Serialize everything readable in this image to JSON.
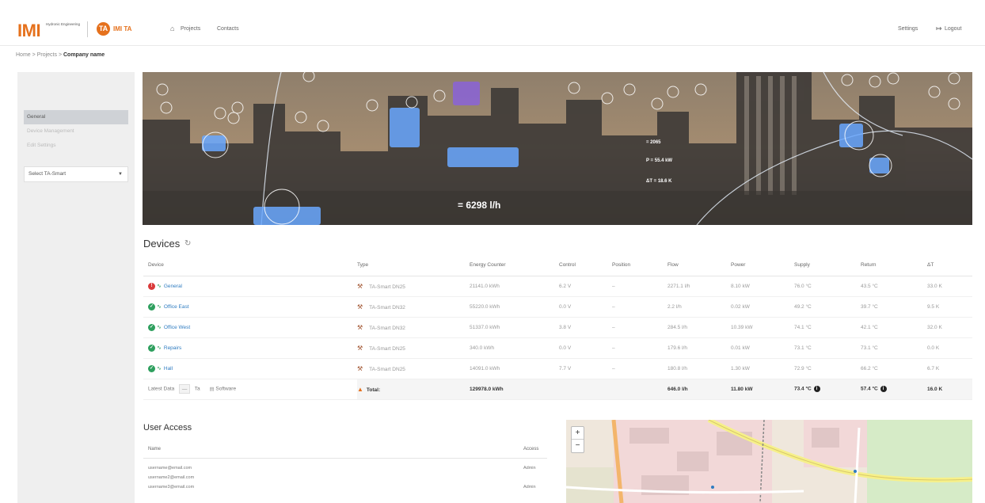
{
  "header": {
    "logo_imi": "IMI",
    "logo_imi_sub": "Hydronic Engineering",
    "logo_ta_icon": "TA",
    "logo_ta_text": "IMI TA",
    "nav": {
      "home_icon": "home-icon",
      "projects": "Projects",
      "contacts": "Contacts"
    },
    "settings": "Settings",
    "logout": "Logout"
  },
  "breadcrumb": {
    "home": "Home",
    "sep": ">",
    "projects": "Projects",
    "current": "Company name"
  },
  "sidebar": {
    "items": [
      {
        "label": "General",
        "active": true
      },
      {
        "label": "Device Management",
        "active": false
      },
      {
        "label": "Edit Settings",
        "active": false
      }
    ],
    "select": {
      "value": "Select TA-Smart"
    }
  },
  "hero": {
    "flow_readout": "= 6298 l/h",
    "readout_1": "= 2065",
    "readout_2": "P = 55.4 kW",
    "readout_3": "ΔT = 18.6 K"
  },
  "devices": {
    "title": "Devices",
    "columns": [
      "Device",
      "Type",
      "Energy Counter",
      "Control",
      "Position",
      "Flow",
      "Power",
      "Supply",
      "Return",
      "ΔT"
    ],
    "rows": [
      {
        "status": "error",
        "name": "General",
        "type": "TA-Smart DN25",
        "energy": "21141.0 kWh",
        "control": "6.2 V",
        "position": "–",
        "flow": "2271.1 l/h",
        "power": "8.10 kW",
        "supply": "76.0 °C",
        "return": "43.5 °C",
        "dt": "33.0 K"
      },
      {
        "status": "ok",
        "name": "Office East",
        "type": "TA-Smart DN32",
        "energy": "55220.0 kWh",
        "control": "0.0 V",
        "position": "–",
        "flow": "2.2 l/h",
        "power": "0.02 kW",
        "supply": "49.2 °C",
        "return": "39.7 °C",
        "dt": "9.5 K"
      },
      {
        "status": "ok",
        "name": "Office West",
        "type": "TA-Smart DN32",
        "energy": "51337.0 kWh",
        "control": "3.8 V",
        "position": "–",
        "flow": "284.5 l/h",
        "power": "10.39 kW",
        "supply": "74.1 °C",
        "return": "42.1 °C",
        "dt": "32.0 K"
      },
      {
        "status": "ok",
        "name": "Repairs",
        "type": "TA-Smart DN25",
        "energy": "340.0 kWh",
        "control": "0.0 V",
        "position": "–",
        "flow": "179.6 l/h",
        "power": "0.01 kW",
        "supply": "73.1 °C",
        "return": "73.1 °C",
        "dt": "0.0 K"
      },
      {
        "status": "ok",
        "name": "Hall",
        "type": "TA-Smart DN25",
        "energy": "14091.0 kWh",
        "control": "7.7 V",
        "position": "–",
        "flow": "180.8 l/h",
        "power": "1.30 kW",
        "supply": "72.9 °C",
        "return": "66.2 °C",
        "dt": "6.7 K"
      }
    ],
    "footer": {
      "latest_data": "Latest Data",
      "btn1": "—",
      "btn2": "Ta",
      "software": "Software",
      "total_label": "Total:",
      "energy": "129978.0 kWh",
      "flow": "646.0 l/h",
      "power": "11.80 kW",
      "supply": "73.4 °C",
      "return": "57.4 °C",
      "dt": "16.0 K"
    }
  },
  "user_access": {
    "title": "User Access",
    "columns": {
      "name": "Name",
      "access": "Access"
    },
    "rows": [
      {
        "name": "username@email.com",
        "access": "Admin"
      },
      {
        "name": "username2@email.com",
        "access": ""
      },
      {
        "name": "username3@email.com",
        "access": "Admin"
      }
    ]
  },
  "map": {
    "zoom_in": "+",
    "zoom_out": "−"
  }
}
